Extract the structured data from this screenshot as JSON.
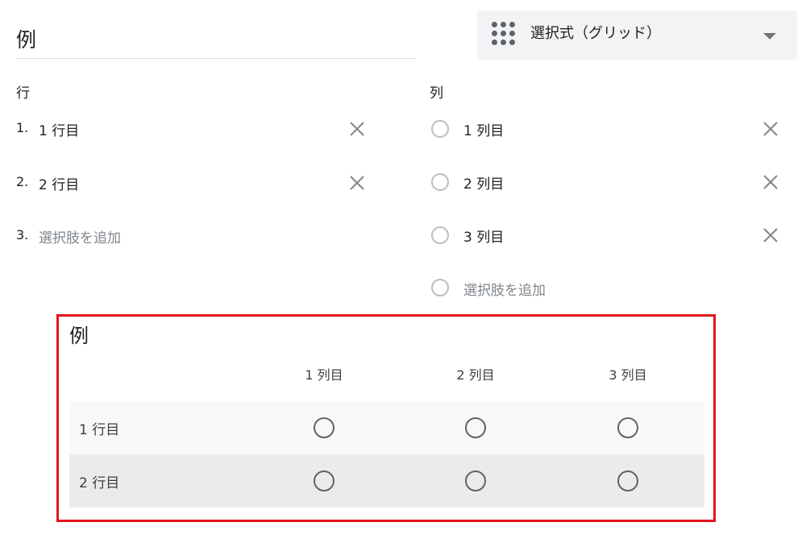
{
  "question": {
    "title": "例"
  },
  "type_select": {
    "icon": "grid-icon",
    "label": "選択式（グリッド）"
  },
  "rows_section": {
    "label": "行",
    "items": [
      {
        "num": "1.",
        "text": "1 行目"
      },
      {
        "num": "2.",
        "text": "2 行目"
      }
    ],
    "add": {
      "num": "3.",
      "placeholder": "選択肢を追加"
    }
  },
  "cols_section": {
    "label": "列",
    "items": [
      {
        "text": "1 列目"
      },
      {
        "text": "2 列目"
      },
      {
        "text": "3 列目"
      }
    ],
    "add": {
      "placeholder": "選択肢を追加"
    }
  },
  "preview": {
    "title": "例",
    "columns": [
      "1 列目",
      "2 列目",
      "3 列目"
    ],
    "rows": [
      "1 行目",
      "2 行目"
    ]
  },
  "colors": {
    "highlight_border": "#e3141e",
    "row_odd": "#f8f8f8",
    "row_even": "#ebebeb"
  }
}
